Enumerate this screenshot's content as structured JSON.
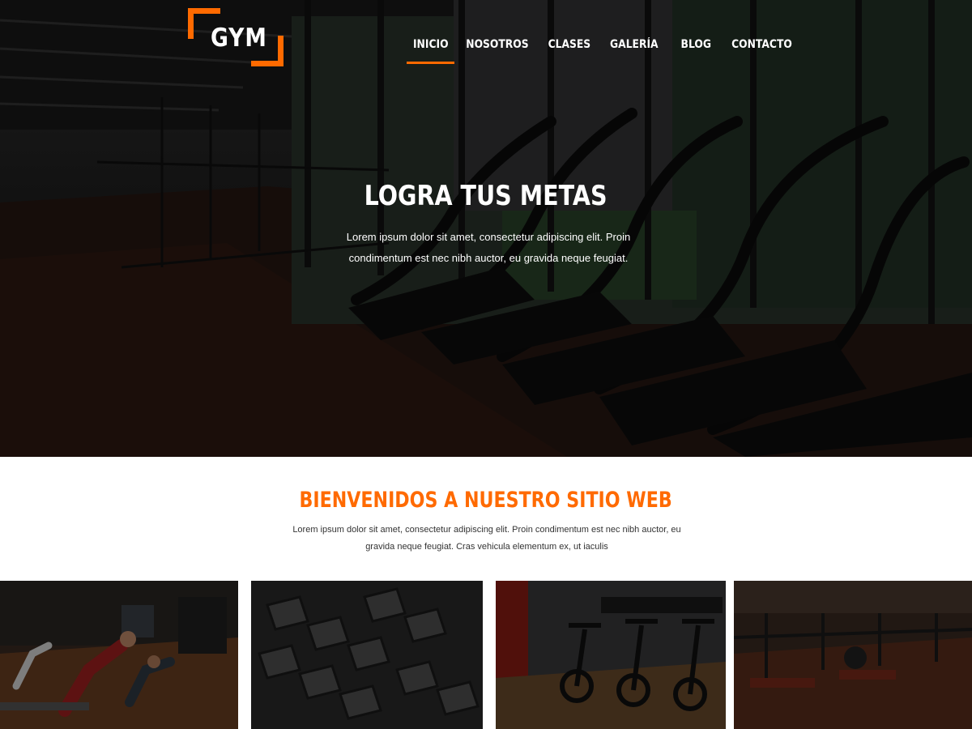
{
  "brand": {
    "logo_text": "GYM",
    "accent_color": "#ff6a00"
  },
  "nav": {
    "items": [
      {
        "label": "INICIO",
        "active": true
      },
      {
        "label": "NOSOTROS",
        "active": false
      },
      {
        "label": "CLASES",
        "active": false
      },
      {
        "label": "GALERÍA",
        "active": false
      },
      {
        "label": "BLOG",
        "active": false
      },
      {
        "label": "CONTACTO",
        "active": false
      }
    ]
  },
  "hero": {
    "title": "LOGRA TUS METAS",
    "subtitle": "Lorem ipsum dolor sit amet, consectetur adipiscing elit. Proin condimentum est nec nibh auctor, eu gravida neque feugiat."
  },
  "welcome": {
    "title": "BIENVENIDOS A NUESTRO SITIO WEB",
    "text": "Lorem ipsum dolor sit amet, consectetur adipiscing elit. Proin condimentum est nec nibh auctor, eu gravida neque feugiat. Cras vehicula elementum ex, ut iaculis"
  },
  "gallery": {
    "images": [
      "yoga-class-photo",
      "dumbbell-rack-photo",
      "spinning-bikes-photo",
      "weight-room-photo"
    ]
  }
}
